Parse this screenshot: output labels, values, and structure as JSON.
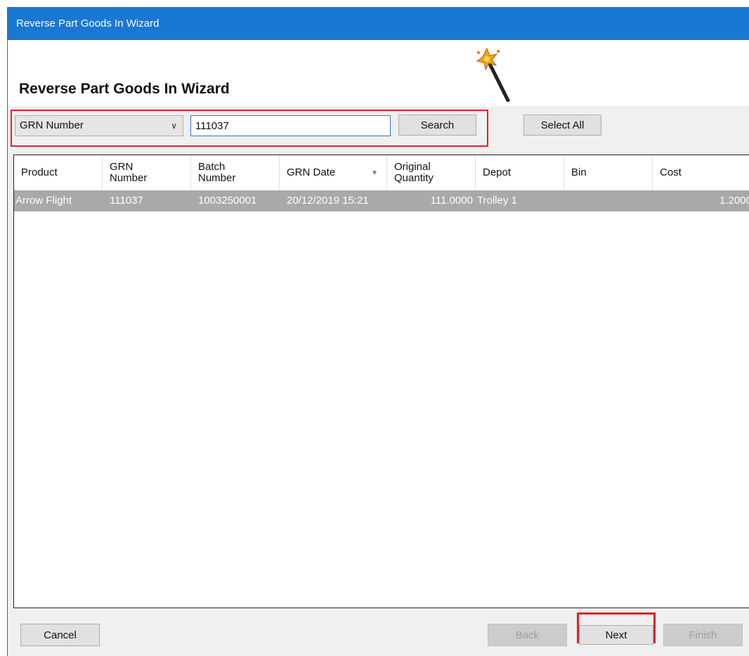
{
  "window": {
    "title": "Reverse Part Goods In Wizard"
  },
  "header": {
    "title": "Reverse Part Goods In Wizard"
  },
  "toolbar": {
    "search_field": "GRN Number",
    "search_value": "111037",
    "search_label": "Search",
    "select_all_label": "Select All"
  },
  "table": {
    "columns": [
      {
        "label": "Product"
      },
      {
        "label": "GRN\nNumber"
      },
      {
        "label": "Batch\nNumber"
      },
      {
        "label": "GRN Date"
      },
      {
        "label": "Original\nQuantity"
      },
      {
        "label": "Depot"
      },
      {
        "label": "Bin"
      },
      {
        "label": "Cost"
      }
    ],
    "rows": [
      {
        "product": "Arrow Flight",
        "grn_number": "111037",
        "batch_number": "1003250001",
        "grn_date": "20/12/2019 15:21",
        "original_quantity": "111.0000",
        "depot": "Trolley 1",
        "bin": "",
        "cost": "1.2000"
      }
    ]
  },
  "footer": {
    "cancel_label": "Cancel",
    "back_label": "Back",
    "next_label": "Next",
    "finish_label": "Finish"
  },
  "colors": {
    "title_bar": "#1a78d3",
    "highlight": "#e3202a",
    "selected_row": "#a9a9a9"
  }
}
